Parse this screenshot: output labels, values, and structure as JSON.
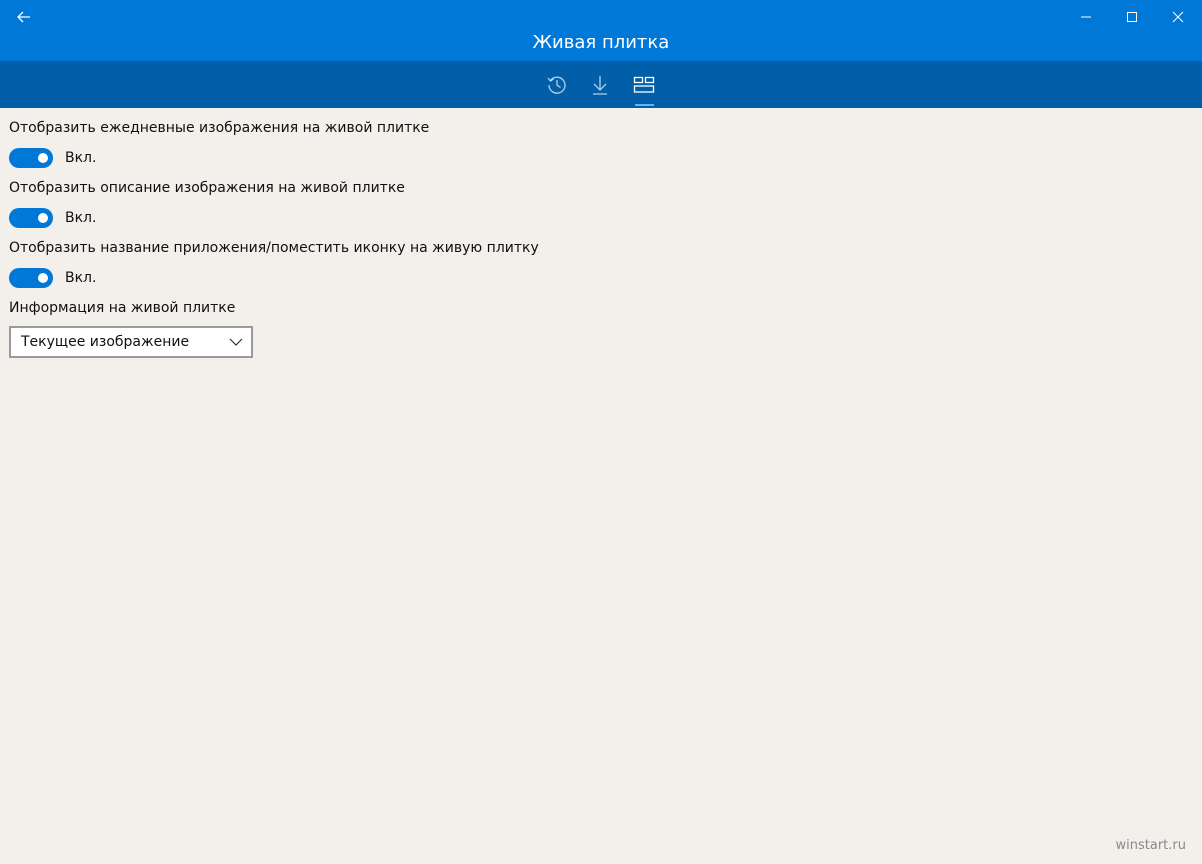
{
  "window": {
    "title": "Живая плитка"
  },
  "nav": {
    "tabs": [
      {
        "icon": "history-icon"
      },
      {
        "icon": "download-icon"
      },
      {
        "icon": "live-tile-icon",
        "active": true
      }
    ]
  },
  "settings": [
    {
      "label": "Отобразить ежедневные изображения на живой плитке",
      "state": "Вкл."
    },
    {
      "label": "Отобразить описание изображения на живой плитке",
      "state": "Вкл."
    },
    {
      "label": "Отобразить название приложения/поместить иконку на живую плитку",
      "state": "Вкл."
    }
  ],
  "tile_info": {
    "label": "Информация на живой плитке",
    "selected": "Текущее изображение"
  },
  "watermark": "winstart.ru",
  "colors": {
    "accent": "#0078d7",
    "nav_bar": "#005fa8",
    "background": "#f3efeb"
  }
}
